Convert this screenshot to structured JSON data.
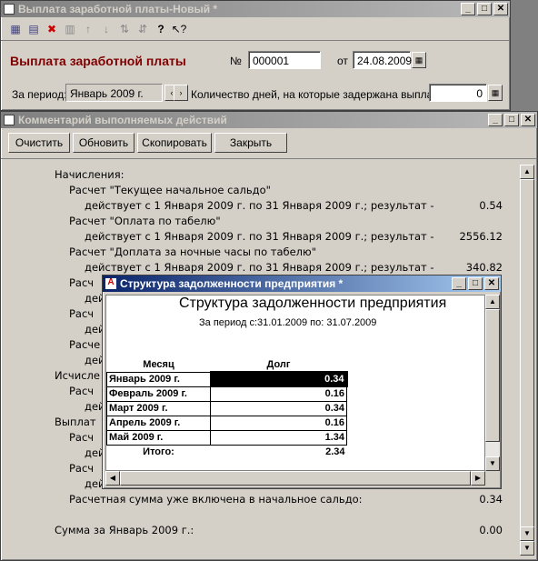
{
  "main_window": {
    "title": "Выплата заработной платы-Новый *",
    "doc_title": "Выплата заработной платы",
    "num_label": "№",
    "num_value": "000001",
    "from_label": "от",
    "date_value": "24.08.2009",
    "period_label": "За период:",
    "period_value": "Январь 2009 г.",
    "days_label": "Количество дней, на которые задержана выплата:",
    "days_value": "0"
  },
  "log_window": {
    "title": "Комментарий выполняемых действий",
    "buttons": [
      "Очистить",
      "Обновить",
      "Скопировать",
      "Закрыть"
    ],
    "lines": [
      {
        "text": "Начисления:",
        "indent": 0,
        "value": ""
      },
      {
        "text": "Расчет \"Текущее начальное сальдо\"",
        "indent": 1,
        "value": ""
      },
      {
        "text": "действует с 1 Января 2009 г. по 31 Января 2009 г.; результат -",
        "indent": 2,
        "value": "0.54"
      },
      {
        "text": "Расчет \"Оплата по табелю\"",
        "indent": 1,
        "value": ""
      },
      {
        "text": "действует с 1 Января 2009 г. по 31 Января 2009 г.; результат -",
        "indent": 2,
        "value": "2556.12"
      },
      {
        "text": "Расчет \"Доплата за ночные часы по табелю\"",
        "indent": 1,
        "value": ""
      },
      {
        "text": "действует с 1 Января 2009 г. по 31 Января 2009 г.; результат -",
        "indent": 2,
        "value": "340.82"
      },
      {
        "text": "Расч",
        "indent": 1,
        "value": ""
      },
      {
        "text": "дей",
        "indent": 2,
        "value": ""
      },
      {
        "text": "Расч",
        "indent": 1,
        "value": ""
      },
      {
        "text": "дей",
        "indent": 2,
        "value": ""
      },
      {
        "text": "Расче",
        "indent": 1,
        "value": ""
      },
      {
        "text": "дей",
        "indent": 2,
        "value": ""
      },
      {
        "text": "Исчисле",
        "indent": 0,
        "value": ""
      },
      {
        "text": "Расч",
        "indent": 1,
        "value": ""
      },
      {
        "text": "дей",
        "indent": 2,
        "value": ""
      },
      {
        "text": "Выплат",
        "indent": 0,
        "value": ""
      },
      {
        "text": "Расч",
        "indent": 1,
        "value": ""
      },
      {
        "text": "дей",
        "indent": 2,
        "value": ""
      },
      {
        "text": "Расч",
        "indent": 1,
        "value": ""
      },
      {
        "text": "дей",
        "indent": 2,
        "value": ""
      },
      {
        "text": "Расчетная сумма уже включена в начальное сальдо:",
        "indent": 1,
        "value": "0.34"
      },
      {
        "text": "",
        "indent": 0,
        "value": ""
      },
      {
        "text": "Сумма за Январь 2009 г.:",
        "indent": 0,
        "value": "0.00"
      }
    ]
  },
  "report_window": {
    "title": "Структура задолженности предприятия  *",
    "heading": "Структура задолженности предприятия",
    "period": "За период с:31.01.2009 по: 31.07.2009",
    "col_month": "Месяц",
    "col_debt": "Долг",
    "rows": [
      {
        "month": "Январь 2009 г.",
        "debt": "0.34"
      },
      {
        "month": "Февраль 2009 г.",
        "debt": "0.16"
      },
      {
        "month": "Март 2009 г.",
        "debt": "0.34"
      },
      {
        "month": "Апрель 2009 г.",
        "debt": "0.16"
      },
      {
        "month": "Май 2009 г.",
        "debt": "1.34"
      }
    ],
    "total_label": "Итого:",
    "total_value": "2.34"
  },
  "colors": {
    "doc_title": "#800000",
    "active_title": "#0a246a",
    "inactive_title": "#808080"
  }
}
